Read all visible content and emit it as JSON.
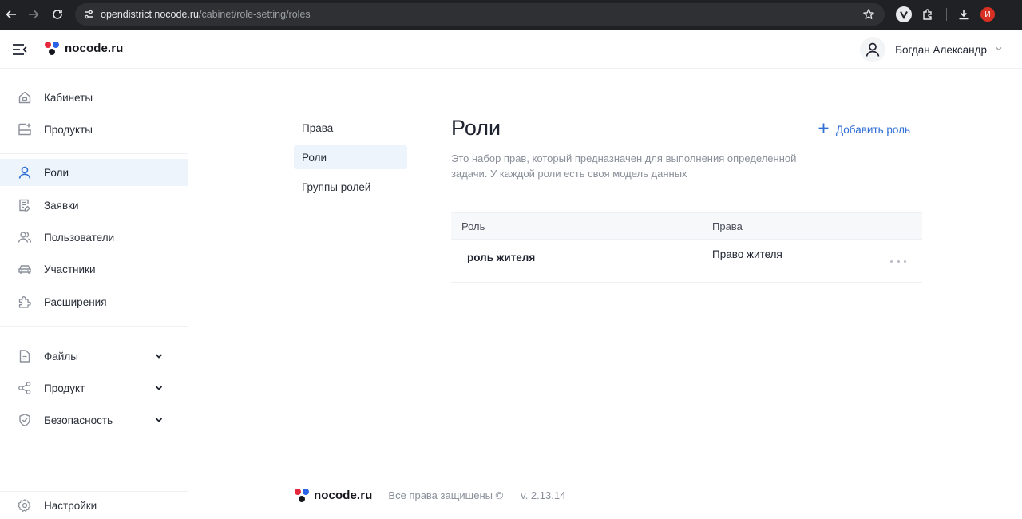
{
  "browser": {
    "url_host": "opendistrict.nocode.ru",
    "url_path": "/cabinet/role-setting/roles",
    "profile_initial": "И"
  },
  "header": {
    "logo_text": "nocode.ru",
    "user_name": "Богдан Александр"
  },
  "sidebar": {
    "items": [
      {
        "label": "Кабинеты",
        "icon": "home-icon"
      },
      {
        "label": "Продукты",
        "icon": "product-add-icon"
      },
      {
        "label": "Роли",
        "icon": "user-icon",
        "active": true
      },
      {
        "label": "Заявки",
        "icon": "document-edit-icon"
      },
      {
        "label": "Пользователи",
        "icon": "users-icon"
      },
      {
        "label": "Участники",
        "icon": "car-icon"
      },
      {
        "label": "Расширения",
        "icon": "puzzle-icon"
      },
      {
        "label": "Файлы",
        "icon": "file-icon"
      },
      {
        "label": "Продукт",
        "icon": "share-icon"
      },
      {
        "label": "Безопасность",
        "icon": "shield-icon"
      },
      {
        "label": "Настройки",
        "icon": "gear-icon"
      }
    ]
  },
  "subnav": {
    "items": [
      {
        "label": "Права"
      },
      {
        "label": "Роли",
        "active": true
      },
      {
        "label": "Группы ролей"
      }
    ]
  },
  "main": {
    "title": "Роли",
    "add_button": "Добавить роль",
    "description": "Это набор прав, который предназначен для выполнения определенной задачи. У каждой роли есть своя модель данных",
    "table": {
      "columns": [
        "Роль",
        "Права"
      ],
      "rows": [
        {
          "role": "роль жителя",
          "rights": "Право жителя"
        }
      ]
    }
  },
  "footer": {
    "logo_text": "nocode.ru",
    "copyright": "Все права защищены ©",
    "version": "v. 2.13.14"
  },
  "colors": {
    "accent": "#2f6fd6",
    "active_bg": "#eef4fc",
    "logo_red": "#e5283b",
    "logo_blue": "#2a63e8",
    "logo_dark": "#14161c"
  }
}
